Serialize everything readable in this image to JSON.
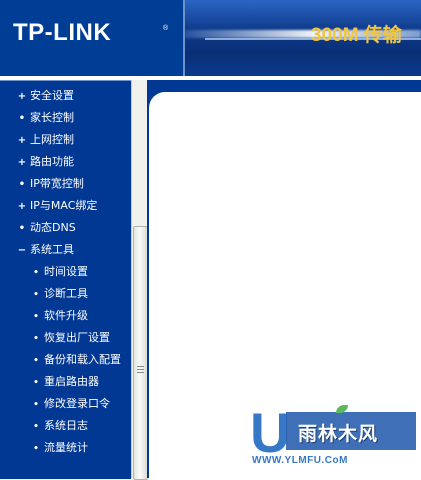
{
  "header": {
    "logo": "TP-LINK",
    "logo_mark": "®",
    "banner_text": "300M 传输"
  },
  "sidebar": {
    "items": [
      {
        "label": "安全设置",
        "marker": "+",
        "level": 0
      },
      {
        "label": "家长控制",
        "marker": "•",
        "level": 0
      },
      {
        "label": "上网控制",
        "marker": "+",
        "level": 0
      },
      {
        "label": "路由功能",
        "marker": "+",
        "level": 0
      },
      {
        "label": "IP带宽控制",
        "marker": "•",
        "level": 0
      },
      {
        "label": "IP与MAC绑定",
        "marker": "+",
        "level": 0
      },
      {
        "label": "动态DNS",
        "marker": "•",
        "level": 0
      },
      {
        "label": "系统工具",
        "marker": "−",
        "level": 0
      },
      {
        "label": "时间设置",
        "marker": "•",
        "level": 1
      },
      {
        "label": "诊断工具",
        "marker": "•",
        "level": 1
      },
      {
        "label": "软件升级",
        "marker": "•",
        "level": 1
      },
      {
        "label": "恢复出厂设置",
        "marker": "•",
        "level": 1
      },
      {
        "label": "备份和载入配置",
        "marker": "•",
        "level": 1
      },
      {
        "label": "重启路由器",
        "marker": "•",
        "level": 1
      },
      {
        "label": "修改登录口令",
        "marker": "•",
        "level": 1
      },
      {
        "label": "系统日志",
        "marker": "•",
        "level": 1
      },
      {
        "label": "流量统计",
        "marker": "•",
        "level": 1
      }
    ]
  },
  "watermark": {
    "letter": "U",
    "name": "雨林木风",
    "url": "WWW.YLMFU.CoM"
  },
  "colors": {
    "nav_bg": "#003894",
    "header_bg": "#003d95",
    "banner_text": "#f3c63e"
  }
}
